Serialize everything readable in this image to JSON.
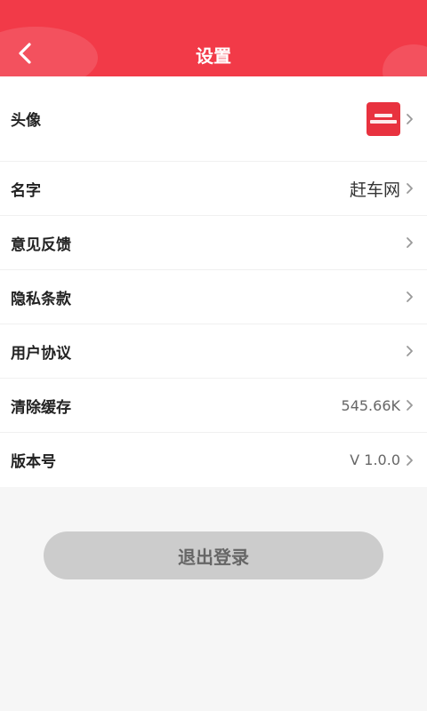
{
  "header": {
    "title": "设置",
    "back_icon": "chevron-left-icon",
    "background": "#f23a48"
  },
  "settings": {
    "avatar": {
      "label": "头像",
      "icon": "avatar-image"
    },
    "name": {
      "label": "名字",
      "value": "赶车网"
    },
    "feedback": {
      "label": "意见反馈"
    },
    "privacy": {
      "label": "隐私条款"
    },
    "agreement": {
      "label": "用户协议"
    },
    "cache": {
      "label": "清除缓存",
      "value": "545.66K"
    },
    "version": {
      "label": "版本号",
      "value": "V 1.0.0"
    }
  },
  "logout": {
    "label": "退出登录",
    "background": "#cccccc"
  }
}
